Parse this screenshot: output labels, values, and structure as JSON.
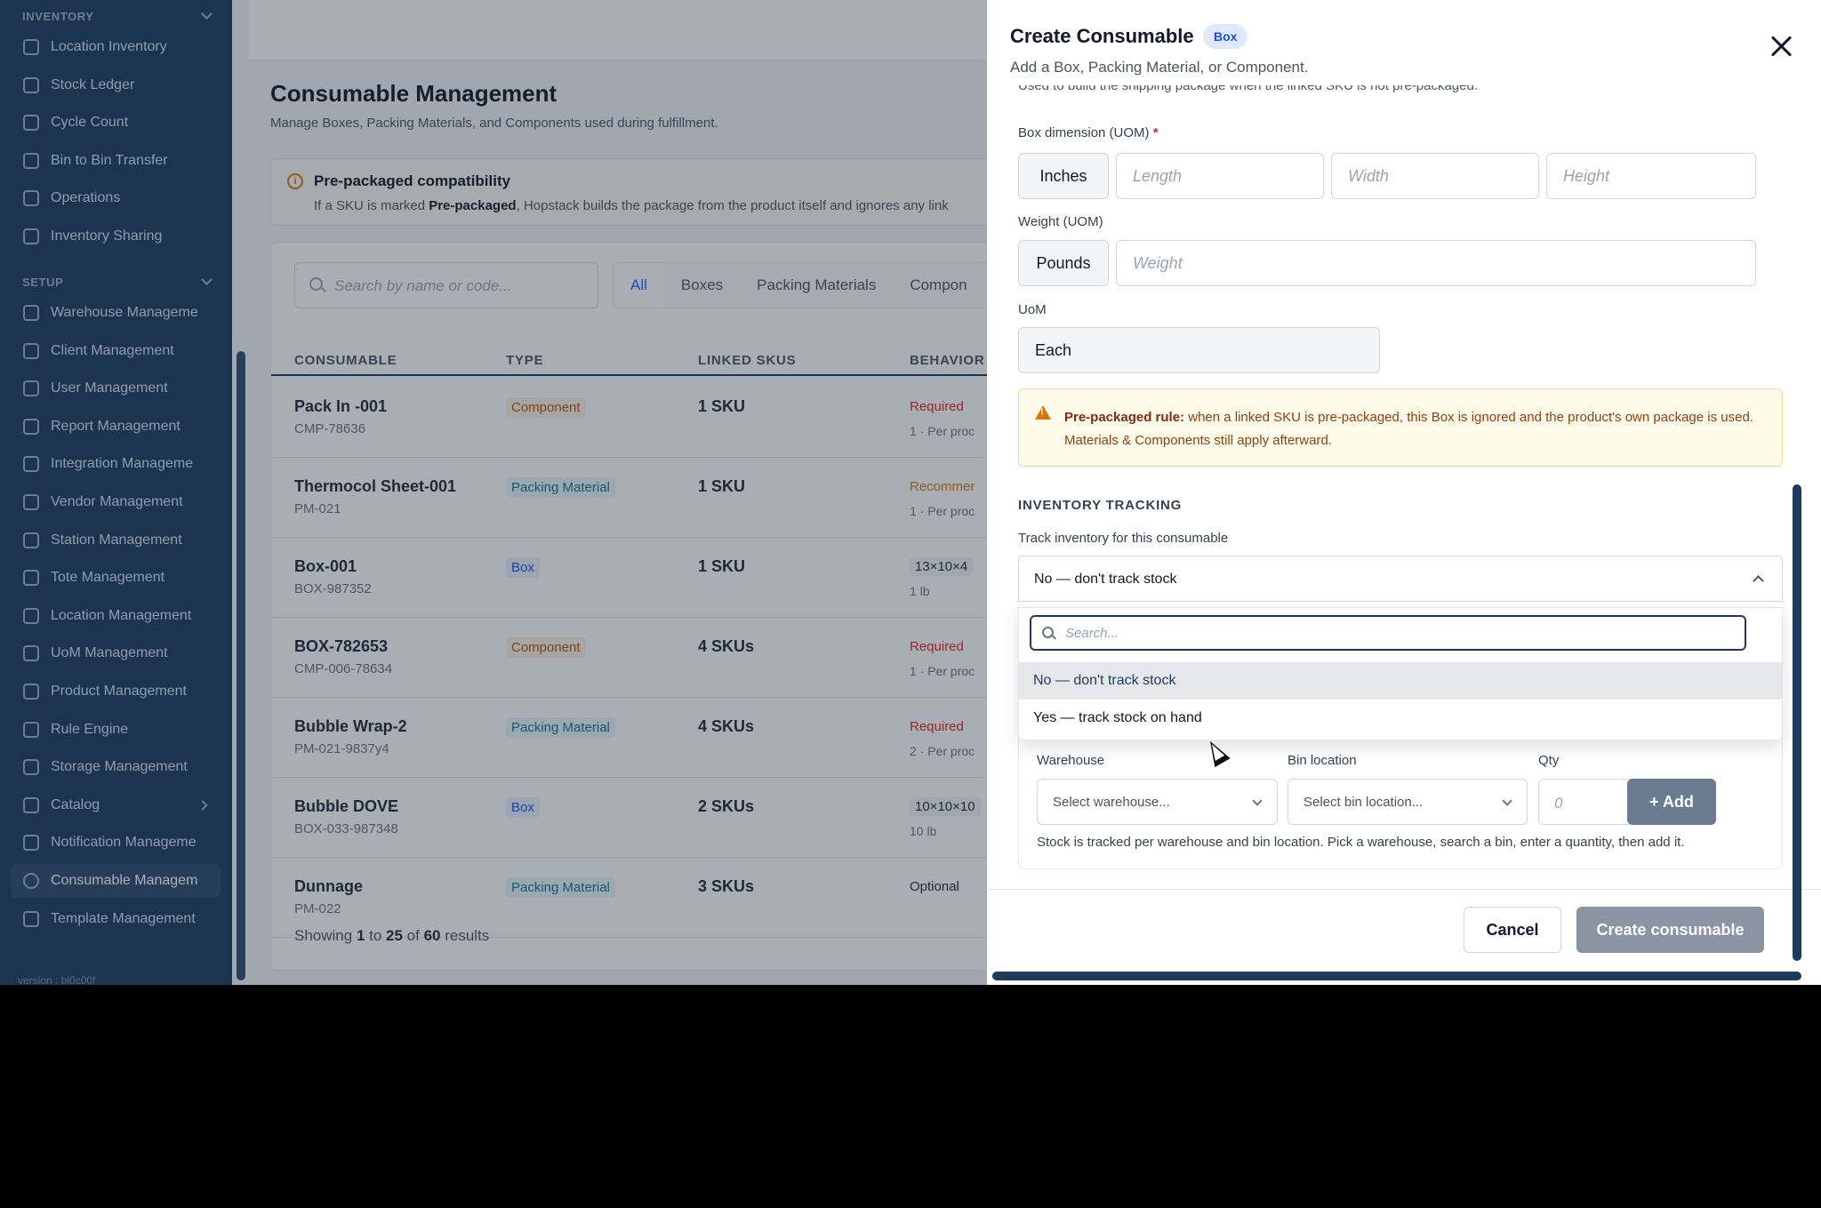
{
  "sidebar": {
    "sections": {
      "inventory": "INVENTORY",
      "setup": "SETUP"
    },
    "inventory_items": [
      {
        "label": "Location Inventory",
        "icon": "building-icon"
      },
      {
        "label": "Stock Ledger",
        "icon": "ledger-icon"
      },
      {
        "label": "Cycle Count",
        "icon": "refresh-icon"
      },
      {
        "label": "Bin to Bin Transfer",
        "icon": "transfer-icon"
      },
      {
        "label": "Operations",
        "icon": "box-icon"
      },
      {
        "label": "Inventory Sharing",
        "icon": "link-icon"
      }
    ],
    "setup_items": [
      {
        "label": "Warehouse Manageme",
        "icon": "home-icon"
      },
      {
        "label": "Client Management",
        "icon": "briefcase-icon"
      },
      {
        "label": "User Management",
        "icon": "user-icon"
      },
      {
        "label": "Report Management",
        "icon": "chart-icon"
      },
      {
        "label": "Integration Manageme",
        "icon": "link-icon"
      },
      {
        "label": "Vendor Management",
        "icon": "store-icon"
      },
      {
        "label": "Station Management",
        "icon": "monitor-icon"
      },
      {
        "label": "Tote Management",
        "icon": "tote-icon"
      },
      {
        "label": "Location Management",
        "icon": "building-icon"
      },
      {
        "label": "UoM Management",
        "icon": "ruler-icon"
      },
      {
        "label": "Product Management",
        "icon": "tag-icon"
      },
      {
        "label": "Rule Engine",
        "icon": "rule-icon"
      },
      {
        "label": "Storage Management",
        "icon": "grid-icon"
      },
      {
        "label": "Catalog",
        "icon": "catalog-icon"
      },
      {
        "label": "Notification Manageme",
        "icon": "bell-icon"
      },
      {
        "label": "Consumable Managem",
        "icon": "consumable-icon"
      },
      {
        "label": "Template Management",
        "icon": "template-icon"
      }
    ],
    "version": "version : bl0c00f"
  },
  "main": {
    "title": "Consumable Management",
    "subtitle": "Manage Boxes, Packing Materials, and Components used during fulfillment.",
    "info": {
      "title": "Pre-packaged compatibility",
      "text_before": "If a SKU is marked ",
      "text_bold": "Pre-packaged",
      "text_after": ", Hopstack builds the package from the product itself and ignores any link"
    },
    "search_placeholder": "Search by name or code...",
    "filter_tabs": [
      "All",
      "Boxes",
      "Packing Materials",
      "Compon"
    ],
    "columns": {
      "consumable": "CONSUMABLE",
      "type": "TYPE",
      "linked_skus": "LINKED SKUS",
      "behavior": "BEHAVIOR"
    },
    "rows": [
      {
        "name": "Pack In -001",
        "code": "CMP-78636",
        "type": "Component",
        "type_class": "component",
        "skus": "1 SKU",
        "behavior": "Required",
        "behavior_class": "req",
        "detail": "1 · Per proc"
      },
      {
        "name": "Thermocol Sheet-001",
        "code": "PM-021",
        "type": "Packing Material",
        "type_class": "packing",
        "skus": "1 SKU",
        "behavior": "Recommer",
        "behavior_class": "rec",
        "detail": "1 · Per proc"
      },
      {
        "name": "Box-001",
        "code": "BOX-987352",
        "type": "Box",
        "type_class": "box",
        "skus": "1 SKU",
        "behavior": "13×10×4",
        "behavior_class": "dim",
        "detail": "1 lb"
      },
      {
        "name": "BOX-782653",
        "code": "CMP-006-78634",
        "type": "Component",
        "type_class": "component",
        "skus": "4 SKUs",
        "behavior": "Required",
        "behavior_class": "req",
        "detail": "1 · Per proc"
      },
      {
        "name": "Bubble Wrap-2",
        "code": "PM-021-9837y4",
        "type": "Packing Material",
        "type_class": "packing",
        "skus": "4 SKUs",
        "behavior": "Required",
        "behavior_class": "req",
        "detail": "2 · Per proc"
      },
      {
        "name": "Bubble DOVE",
        "code": "BOX-033-987348",
        "type": "Box",
        "type_class": "box",
        "skus": "2 SKUs",
        "behavior": "10×10×10",
        "behavior_class": "dim",
        "detail": "10 lb"
      },
      {
        "name": "Dunnage",
        "code": "PM-022",
        "type": "Packing Material",
        "type_class": "packing",
        "skus": "3 SKUs",
        "behavior": "Optional",
        "behavior_class": "opt",
        "detail": ""
      }
    ],
    "pager": {
      "prefix": "Showing ",
      "from": "1",
      "to_word": " to ",
      "to": "25",
      "of_word": " of ",
      "total": "60",
      "suffix": " results"
    }
  },
  "drawer": {
    "title": "Create Consumable",
    "badge": "Box",
    "subtitle": "Add a Box, Packing Material, or Component.",
    "cut_text": "Used to build the shipping package when the linked SKU is not pre-packaged.",
    "box_dimension_label": "Box dimension (UOM)",
    "required_mark": "*",
    "dimension_unit": "Inches",
    "length_placeholder": "Length",
    "width_placeholder": "Width",
    "height_placeholder": "Height",
    "weight_label": "Weight (UOM)",
    "weight_unit": "Pounds",
    "weight_placeholder": "Weight",
    "uom_label": "UoM",
    "uom_value": "Each",
    "rule": {
      "bold": "Pre-packaged rule:",
      "text": " when a linked SKU is pre-packaged, this Box is ignored and the product's own package is used. Materials & Components still apply afterward."
    },
    "inventory_heading": "INVENTORY TRACKING",
    "track_label": "Track inventory for this consumable",
    "track_value": "No — don't track stock",
    "dropdown": {
      "search_placeholder": "Search...",
      "options": [
        "No — don't track stock",
        "Yes — track stock on hand"
      ]
    },
    "stock": {
      "warehouse_label": "Warehouse",
      "warehouse_placeholder": "Select warehouse...",
      "bin_label": "Bin location",
      "bin_placeholder": "Select bin location...",
      "qty_label": "Qty",
      "qty_placeholder": "0",
      "add_label": "+ Add",
      "help": "Stock is tracked per warehouse and bin location. Pick a warehouse, search a bin, enter a quantity, then add it."
    },
    "cancel_label": "Cancel",
    "create_label": "Create consumable"
  }
}
